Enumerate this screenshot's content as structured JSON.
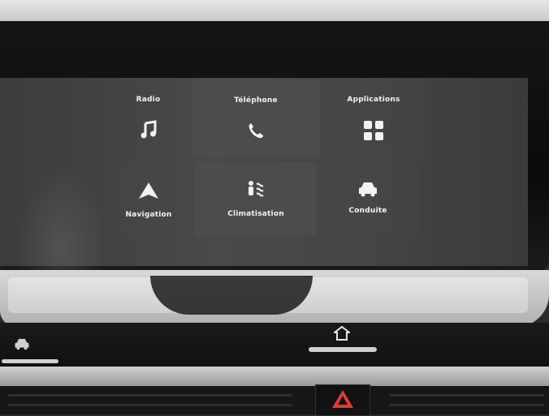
{
  "home_grid": {
    "tiles": [
      {
        "label": "Radio",
        "icon": "music-note-icon"
      },
      {
        "label": "Téléphone",
        "icon": "phone-icon"
      },
      {
        "label": "Applications",
        "icon": "apps-grid-icon"
      },
      {
        "label": "Navigation",
        "icon": "navigation-arrow-icon"
      },
      {
        "label": "Climatisation",
        "icon": "climate-fan-icon"
      },
      {
        "label": "Conduite",
        "icon": "car-icon"
      }
    ]
  },
  "hardware_buttons": [
    {
      "icon": "car-icon"
    },
    {
      "icon": "home-icon"
    },
    {
      "icon": "hazard-warning-icon"
    }
  ],
  "colors": {
    "hazard": "#e23b2e",
    "tile_text": "#f2f2f2"
  }
}
